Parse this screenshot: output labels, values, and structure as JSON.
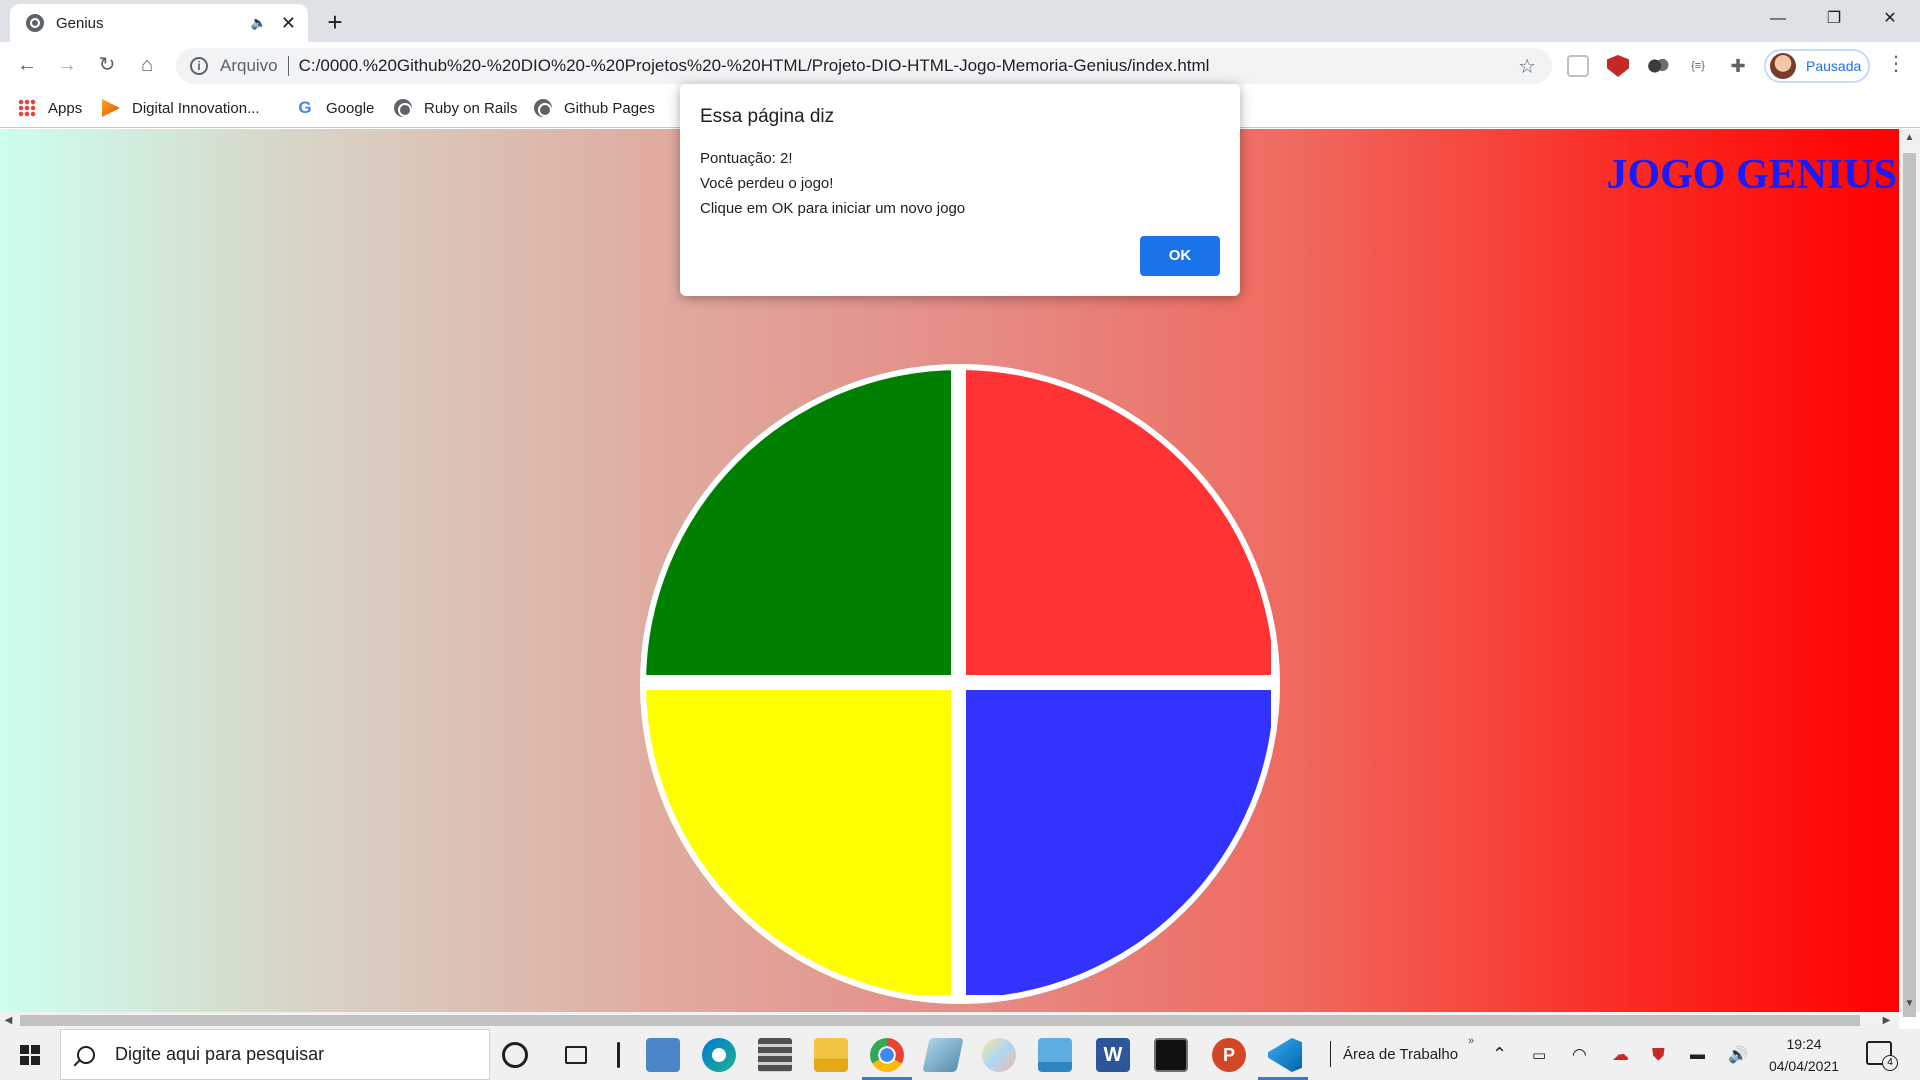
{
  "browser": {
    "tab_title": "Genius",
    "new_tab_label": "+",
    "omnibox": {
      "scheme_label": "Arquivo",
      "url": "C:/0000.%20Github%20-%20DIO%20-%20Projetos%20-%20HTML/Projeto-DIO-HTML-Jogo-Memoria-Genius/index.html"
    },
    "profile_label": "Pausada",
    "bookmarks": [
      {
        "label": "Apps",
        "icon": "apps-grid-icon"
      },
      {
        "label": "Digital Innovation...",
        "icon": "dio-icon"
      },
      {
        "label": "Google",
        "icon": "google-icon"
      },
      {
        "label": "Ruby on Rails",
        "icon": "globe-icon"
      },
      {
        "label": "Github Pages",
        "icon": "globe-icon"
      }
    ]
  },
  "page": {
    "title": "JOGO GENIUS",
    "colors": {
      "green": "#008000",
      "red": "#ff3333",
      "yellow": "#ffff00",
      "blue": "#3333ff",
      "title": "#1a1aff"
    }
  },
  "dialog": {
    "title": "Essa página diz",
    "lines": [
      "Pontuação: 2!",
      "Você perdeu o jogo!",
      "Clique em OK para iniciar um novo jogo"
    ],
    "ok_label": "OK"
  },
  "taskbar": {
    "search_placeholder": "Digite aqui para pesquisar",
    "desktop_label": "Área de Trabalho",
    "time": "19:24",
    "date": "04/04/2021",
    "notification_count": "4"
  }
}
